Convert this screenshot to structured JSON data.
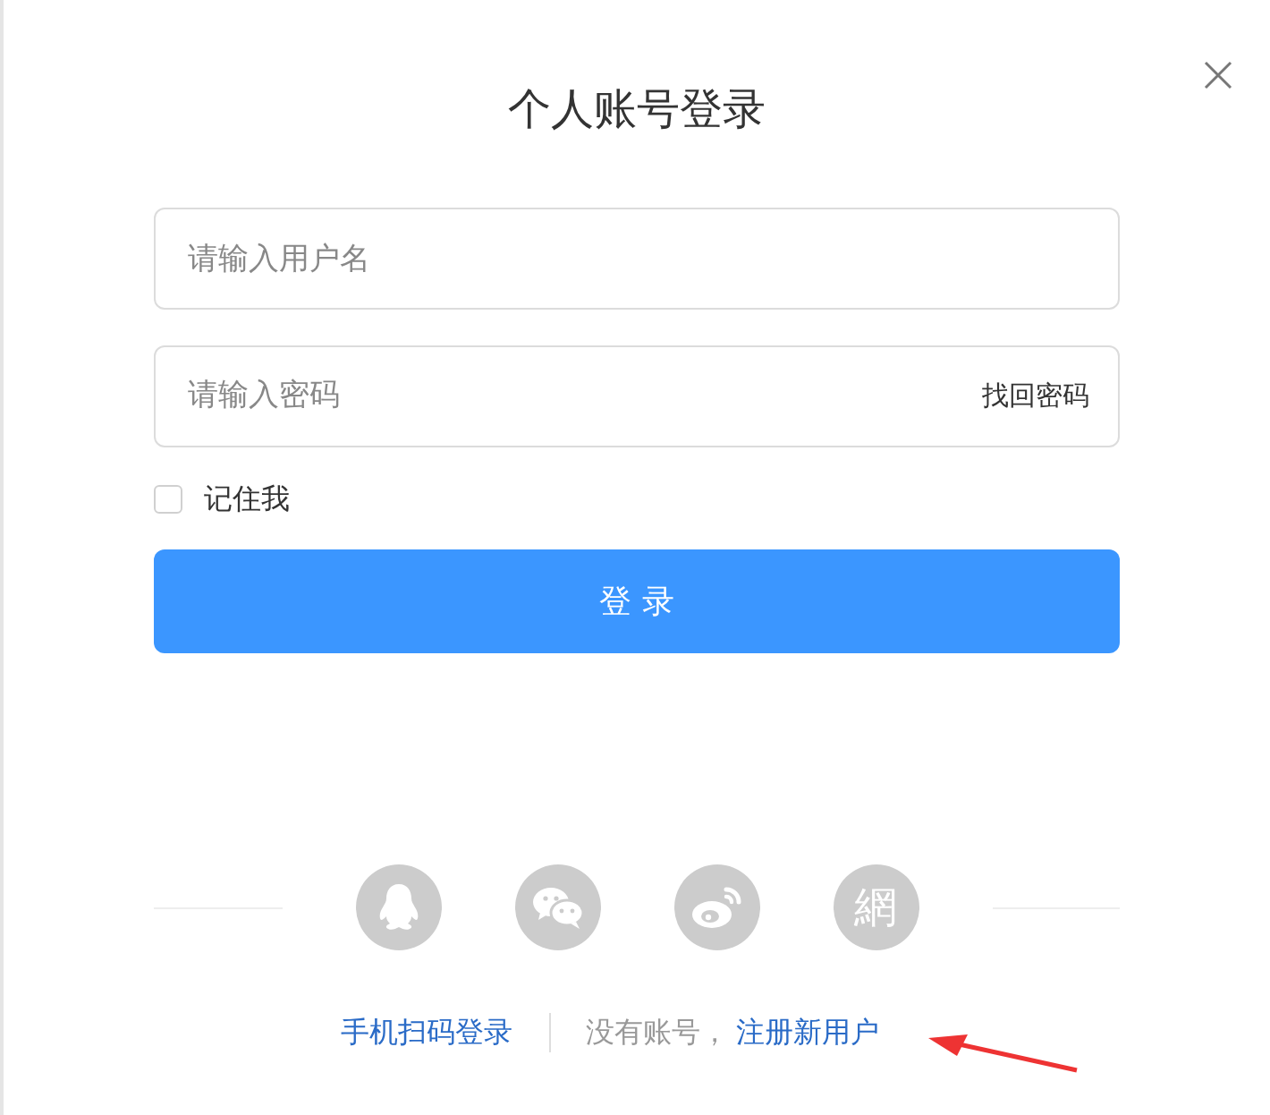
{
  "dialog": {
    "title": "个人账号登录"
  },
  "username": {
    "placeholder": "请输入用户名"
  },
  "password": {
    "placeholder": "请输入密码",
    "link": "找回密码"
  },
  "remember": {
    "label": "记住我",
    "checked": false
  },
  "login_button": "登 录",
  "social": [
    {
      "kind": "qq"
    },
    {
      "kind": "wechat"
    },
    {
      "kind": "weibo"
    },
    {
      "kind": "text",
      "label": "網"
    }
  ],
  "footer": {
    "qr_link": "手机扫码登录",
    "prompt": "没有账号，",
    "register_link": "注册新用户"
  }
}
